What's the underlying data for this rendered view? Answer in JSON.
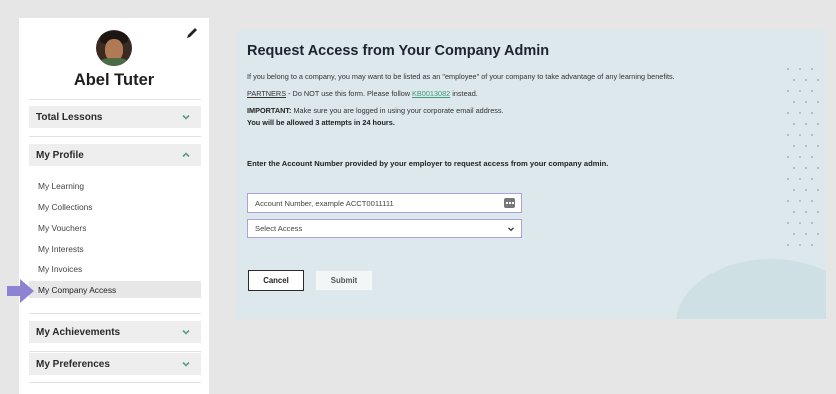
{
  "user": {
    "name": "Abel Tuter"
  },
  "sidebar": {
    "sections": [
      {
        "label": "Total Lessons",
        "state": "collapsed"
      },
      {
        "label": "My Profile",
        "state": "expanded"
      },
      {
        "label": "My Achievements",
        "state": "collapsed"
      },
      {
        "label": "My Preferences",
        "state": "collapsed"
      }
    ],
    "profile_items": [
      {
        "label": "My Learning"
      },
      {
        "label": "My Collections"
      },
      {
        "label": "My Vouchers"
      },
      {
        "label": "My Interests"
      },
      {
        "label": "My Invoices"
      },
      {
        "label": "My Company Access",
        "active": true
      }
    ]
  },
  "main": {
    "title": "Request Access from Your Company Admin",
    "intro": "If you belong to a company, you may want to be listed as an \"employee\" of your company to take advantage of any learning benefits.",
    "partners_label": "PARTNERS",
    "partners_text": " - Do NOT use this form. Please follow ",
    "partners_link": "KB0013082",
    "partners_suffix": " instead.",
    "important_label": "IMPORTANT:",
    "important_text": " Make sure you are logged in using your corporate email address.",
    "attempts_text": "You will be allowed 3 attempts in 24 hours.",
    "enter_text": "Enter the Account Number provided by your employer to request access from your company admin.",
    "account_input": {
      "placeholder": "Account Number, example ACCT0011111"
    },
    "select_access": {
      "value": "Select Access"
    },
    "cancel_label": "Cancel",
    "submit_label": "Submit"
  },
  "colors": {
    "panel_bg": "#dce8ec",
    "input_border": "#a9a3d9",
    "link": "#3f9a7c",
    "pointer_arrow": "#8c84d2",
    "chevron": "#5a9f86"
  },
  "icons": [
    "edit-icon",
    "chevron-down-icon",
    "chevron-up-icon",
    "keyboard-icon",
    "pointer-arrow-icon"
  ]
}
